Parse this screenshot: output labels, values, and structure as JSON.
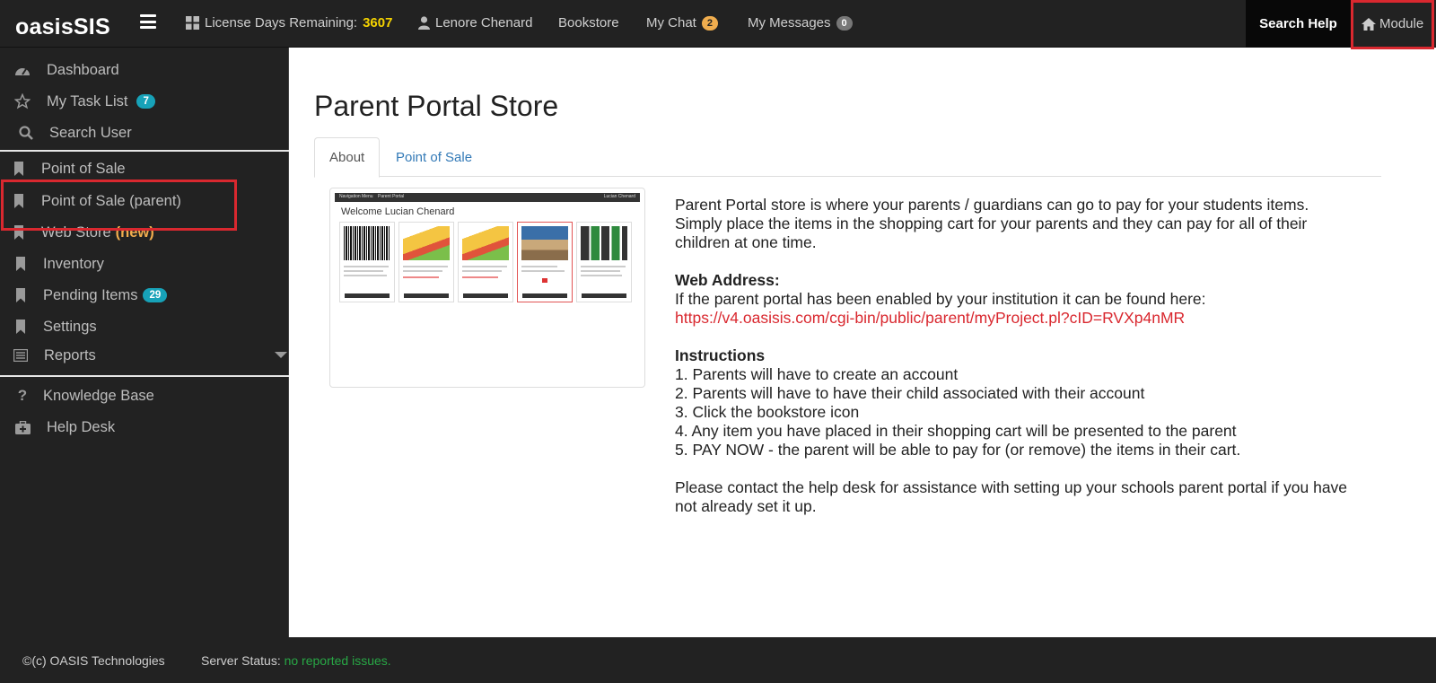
{
  "header": {
    "brand": "oasisSIS",
    "license_label": "License Days Remaining:",
    "license_days": "3607",
    "user_name": "Lenore Chenard",
    "bookstore": "Bookstore",
    "my_chat": "My Chat",
    "my_chat_count": "2",
    "my_messages": "My Messages",
    "my_messages_count": "0",
    "search_help": "Search Help",
    "module": "Module"
  },
  "sidebar": {
    "items": [
      {
        "label": "Dashboard",
        "icon": "dashboard-icon"
      },
      {
        "label": "My Task List",
        "icon": "star-icon",
        "badge": "7"
      },
      {
        "label": "Search User",
        "icon": "search-icon"
      },
      {
        "label": "Point of Sale",
        "icon": "bookmark-icon"
      },
      {
        "label": "Point of Sale (parent)",
        "icon": "bookmark-icon"
      },
      {
        "label": "Web Store",
        "icon": "bookmark-icon",
        "tag": "(new)"
      },
      {
        "label": "Inventory",
        "icon": "bookmark-icon"
      },
      {
        "label": "Pending Items",
        "icon": "bookmark-icon",
        "badge": "29"
      },
      {
        "label": "Settings",
        "icon": "bookmark-icon"
      },
      {
        "label": "Reports",
        "icon": "list-icon"
      },
      {
        "label": "Knowledge Base",
        "icon": "question-icon"
      },
      {
        "label": "Help Desk",
        "icon": "medkit-icon"
      }
    ]
  },
  "main": {
    "title": "Parent Portal Store",
    "tabs": [
      {
        "label": "About"
      },
      {
        "label": "Point of Sale"
      }
    ],
    "preview": {
      "welcome": "Welcome Lucian Chenard",
      "bar_left": "Navigation Menu",
      "bar_mid": "Parent Portal",
      "bar_right": "Lucian Chenard"
    },
    "intro": "Parent Portal store is where your parents / guardians can go to pay for your students items. Simply place the items in the shopping cart for your parents and they can pay for all of their children at one time.",
    "web_address_heading": "Web Address:",
    "web_address_text": "If the parent portal has been enabled by your institution it can be found here:",
    "web_address_url": "https://v4.oasisis.com/cgi-bin/public/parent/myProject.pl?cID=RVXp4nMR",
    "instructions_heading": "Instructions",
    "instructions": [
      "1. Parents will have to create an account",
      "2. Parents will have to have their child associated with their account",
      "3. Click the bookstore icon",
      "4. Any item you have placed in their shopping cart will be presented to the parent",
      "5. PAY NOW - the parent will be able to pay for (or remove) the items in their cart."
    ],
    "contact": "Please contact the help desk for assistance with setting up your schools parent portal if you have not already set it up."
  },
  "footer": {
    "copyright": "©(c) OASIS Technologies",
    "status_label": "Server Status:",
    "status_value": "no reported issues."
  },
  "colors": {
    "navbar": "#222222",
    "accent_badge": "#17a2b8",
    "highlight": "#f5d300",
    "link": "#337ab7",
    "url": "#d9282f",
    "status_ok": "#28a745"
  }
}
